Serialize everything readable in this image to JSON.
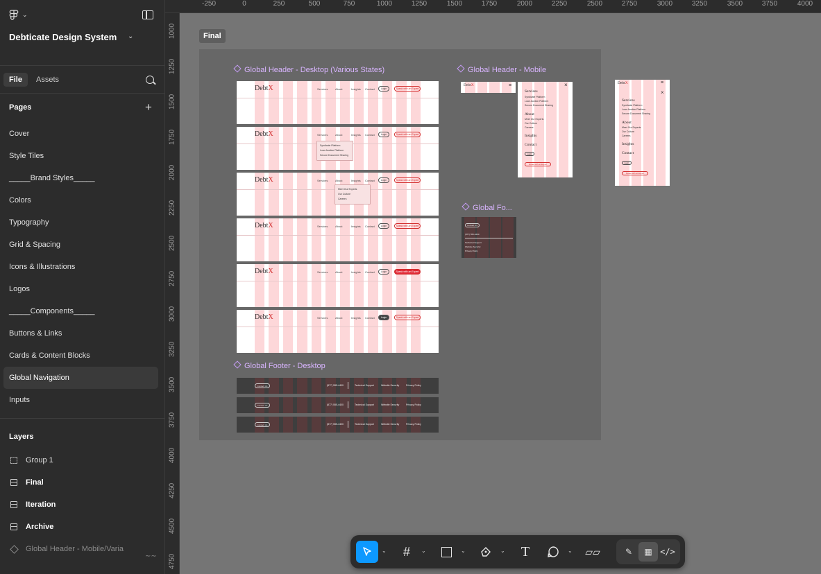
{
  "sidebar": {
    "project_title": "Debticate Design System",
    "tabs": {
      "file": "File",
      "assets": "Assets"
    },
    "pages_heading": "Pages",
    "pages": [
      "Cover",
      "Style Tiles",
      "_____Brand Styles_____",
      "Colors",
      "Typography",
      "Grid & Spacing",
      "Icons & Illustrations",
      "Logos",
      "_____Components_____",
      "Buttons & Links",
      "Cards & Content Blocks",
      "Global Navigation",
      "Inputs"
    ],
    "active_page": "Global Navigation",
    "layers_heading": "Layers",
    "layers": [
      {
        "name": "Group 1",
        "icon": "group-icon"
      },
      {
        "name": "Final",
        "icon": "frame-icon"
      },
      {
        "name": "Iteration",
        "icon": "frame-icon"
      },
      {
        "name": "Archive",
        "icon": "frame-icon"
      },
      {
        "name": "Global Header - Mobile/Varia",
        "icon": "component-icon"
      }
    ]
  },
  "ruler": {
    "top": [
      "-250",
      "0",
      "250",
      "500",
      "750",
      "1000",
      "1250",
      "1500",
      "1750",
      "2000",
      "2250",
      "2500",
      "2750",
      "3000",
      "3250",
      "3500",
      "3750",
      "4000"
    ],
    "left": [
      "1000",
      "1250",
      "1500",
      "1750",
      "2000",
      "2250",
      "2500",
      "2750",
      "3000",
      "3250",
      "3500",
      "3750",
      "4000",
      "4250",
      "4500",
      "4750"
    ]
  },
  "canvas": {
    "frame_label": "Final",
    "section_labels": {
      "header_desktop": "Global Header - Desktop (Various States)",
      "header_mobile": "Global Header - Mobile",
      "footer_mobile": "Global Fo...",
      "footer_desktop": "Global Footer - Desktop"
    },
    "header": {
      "brand_a": "Debt",
      "brand_b": "X",
      "nav_services": "Services",
      "nav_about": "About",
      "nav_insights": "Insights",
      "nav_contact": "Contact",
      "login": "Login",
      "cta": "Speak with an Expert",
      "dropdown_services": [
        "Syndicate Platform",
        "Loan Auction Platform",
        "Secure Document Sharing"
      ],
      "dropdown_about": [
        "Meet Our Experts",
        "Our Culture",
        "Careers"
      ]
    },
    "footer": {
      "contact": "Contact Us",
      "phone": "(877) 555-4400",
      "links": [
        "Technical Support",
        "Website Security",
        "Privacy Policy"
      ]
    },
    "mobile": {
      "services": "Services",
      "about": "About",
      "insights": "Insights",
      "contact": "Contact"
    }
  },
  "toolbar": {
    "tools": [
      "move-tool",
      "frame-tool",
      "shape-tool",
      "pen-tool",
      "text-tool",
      "comment-tool",
      "actions-tool"
    ],
    "modes": [
      "draw-mode",
      "design-mode",
      "dev-mode"
    ]
  },
  "colors": {
    "accent": "#0d99ff",
    "canvas": "#757575",
    "grid_pink": "#fdd7d9",
    "brand_red": "#d32f2f",
    "component_purple": "#d8b4fe"
  }
}
